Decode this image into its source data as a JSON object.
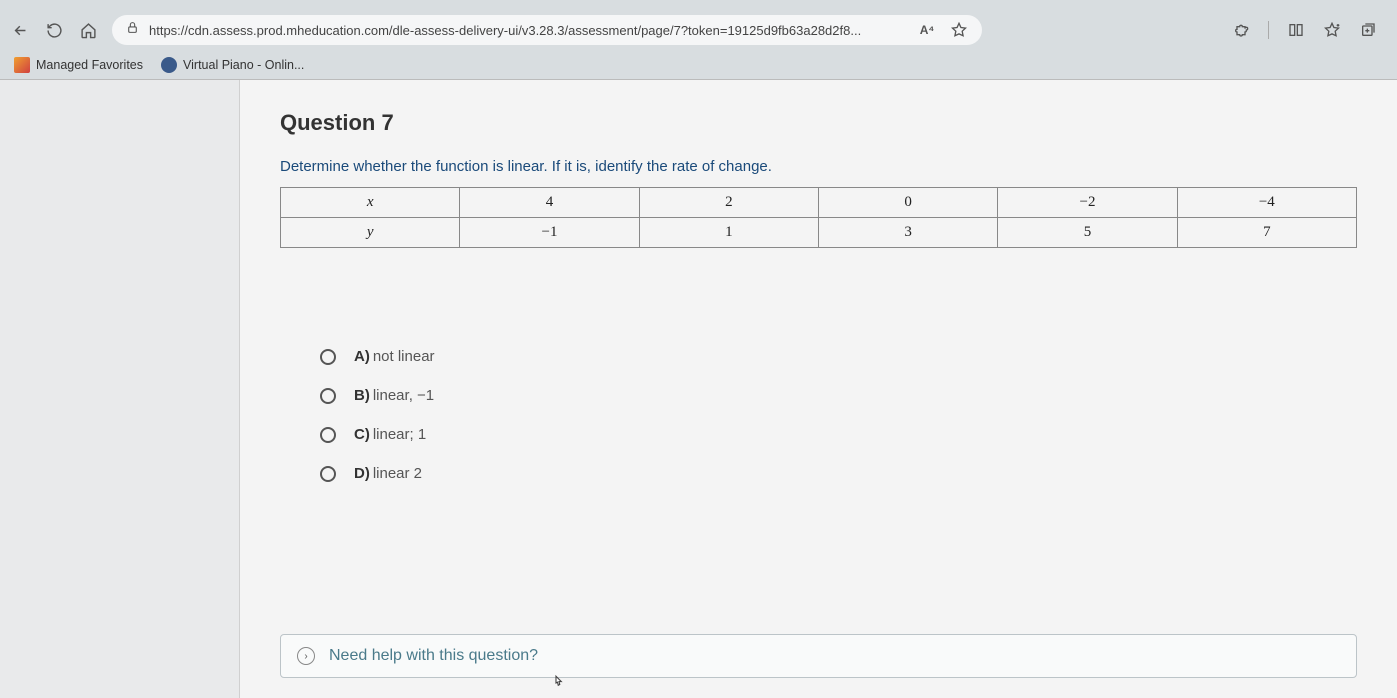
{
  "browser": {
    "url": "https://cdn.assess.prod.mheducation.com/dle-assess-delivery-ui/v3.28.3/assessment/page/7?token=19125d9fb63a28d2f8...",
    "read_aloud_label": "A⁴"
  },
  "bookmarks": [
    {
      "label": "Managed Favorites"
    },
    {
      "label": "Virtual Piano - Onlin..."
    }
  ],
  "question": {
    "title": "Question 7",
    "prompt": "Determine whether the function is linear. If it is, identify the rate of change.",
    "table": {
      "row1_header": "x",
      "row1": [
        "4",
        "2",
        "0",
        "−2",
        "−4"
      ],
      "row2_header": "y",
      "row2": [
        "−1",
        "1",
        "3",
        "5",
        "7"
      ]
    },
    "answers": [
      {
        "key": "A)",
        "text": "not linear"
      },
      {
        "key": "B)",
        "text": "linear, −1"
      },
      {
        "key": "C)",
        "text": "linear; 1"
      },
      {
        "key": "D)",
        "text": "linear 2"
      }
    ]
  },
  "help": {
    "text": "Need help with this question?"
  }
}
